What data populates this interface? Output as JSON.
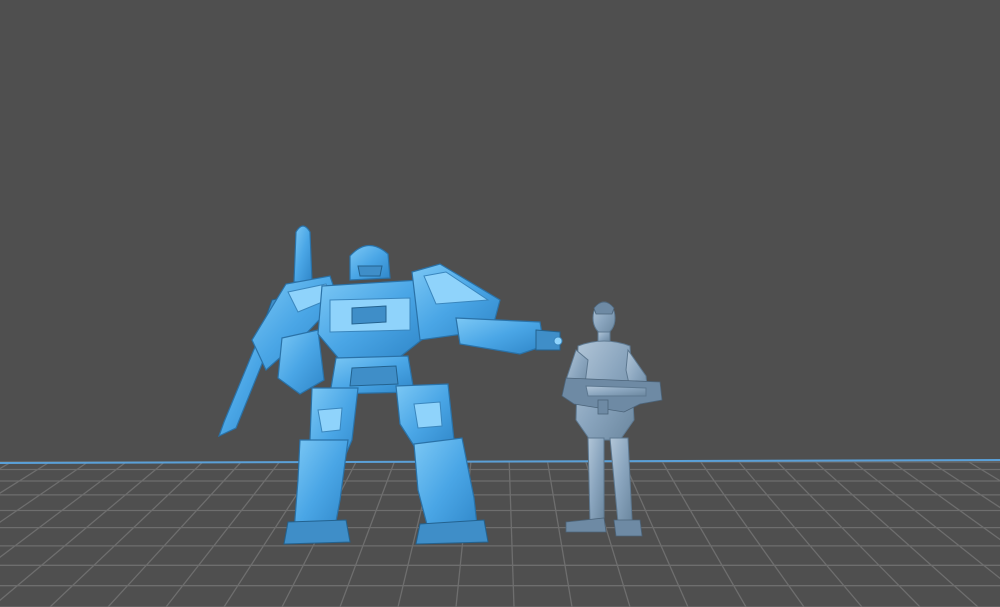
{
  "viewport": {
    "background_color": "#4f4f4f",
    "grid_line_color": "#6e6e6e",
    "floor_edge_color": "#5aa0d8"
  },
  "models": [
    {
      "id": "mech",
      "icon": "mech-robot-model",
      "color": "#4aa6e6",
      "selected": true
    },
    {
      "id": "human",
      "icon": "human-figure-with-rifle-model",
      "color": "#8aa5be",
      "selected": false
    }
  ]
}
